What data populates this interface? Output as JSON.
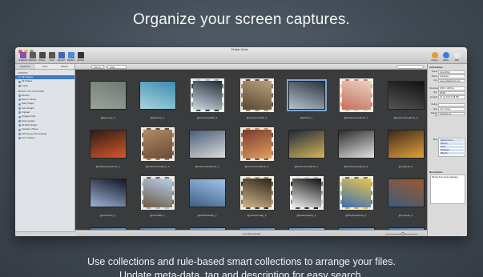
{
  "headline": "Organize your screen captures.",
  "caption": {
    "line1": "Use collections and rule-based smart collections to arrange your files.",
    "line2": "Update meta-data, tag and description for easy search."
  },
  "window": {
    "title": "Pebble Shots",
    "toolbar_left": [
      {
        "label": "Organizer",
        "icon": "organizer-icon",
        "color": "#8a4fb7"
      },
      {
        "label": "Selection",
        "icon": "selection-icon",
        "color": "#5a5a5a"
      },
      {
        "label": "Screen",
        "icon": "screen-icon",
        "color": "#4a4a4a"
      },
      {
        "label": "Timer",
        "icon": "timer-icon",
        "color": "#555555"
      },
      {
        "label": "Record",
        "icon": "record-icon",
        "color": "#3a67b8"
      },
      {
        "label": "Window",
        "icon": "window-icon",
        "color": "#4f87d6"
      },
      {
        "label": "Camera",
        "icon": "camera-icon",
        "color": "#333333"
      }
    ],
    "toolbar_right": [
      {
        "label": "Photos",
        "icon": "photos-icon",
        "color": "#e59a3a"
      },
      {
        "label": "Share",
        "icon": "share-icon",
        "color": "#3b7de0"
      },
      {
        "label": "PDF",
        "icon": "pdf-icon",
        "color": "#e8e8e8"
      }
    ],
    "pathbar": {
      "view_label": "Sort by",
      "sort_value": "Date"
    },
    "sidebar": {
      "tabs": [
        "Organizer",
        "Tools",
        "Effects"
      ],
      "library_heading": "LIBRARY",
      "library_items": [
        "All Images",
        "All Videos",
        "Trash"
      ],
      "smart_heading": "SMART COLLECTIONS",
      "smart_items": [
        "Recent",
        "Screen Shots",
        "Web Snaps",
        "Cam Snaps",
        "Clipped",
        "Dragged Out",
        "Screencasts",
        "All Web Snaps",
        "Favorite Videos",
        "iOS Screen Recordings",
        "Cam Videos"
      ]
    },
    "grid": {
      "rows": [
        [
          "@jaybunty_1",
          "@jaybunty_3",
          "@JCoyneCylalia_3",
          "@JCoyneCylalia_2",
          "@jrlinker_1",
          "@dearlovesnaphots_1",
          "@dearlovesnaphots_2"
        ],
        [
          "@dearlovesnaphots_4",
          "@dearlovesnaphots_3",
          "@dearlovesnaphots_5",
          "@dearlovesnaphots_6",
          "@dearlovesnaphots_7",
          "@dearlovesnaphots_8",
          "@7speeds_2"
        ],
        [
          "@oscaronm_3",
          "@marshaIk_1",
          "@NicDanielson_1",
          "@polzeeronfilly_3",
          "@dearlopelsoln_1",
          "@lifeofsnapshots_1",
          "@7speeds_4"
        ],
        [
          "",
          "",
          "",
          "",
          "",
          "",
          ""
        ]
      ],
      "status": "1 of 128 selected"
    },
    "inspector": {
      "heading": "Information",
      "fields": [
        {
          "label": "Name",
          "value": "Anna Zhen"
        },
        {
          "label": "Album",
          "value": "Instagram"
        },
        {
          "label": "Link",
          "value": "www.pebbleshots.com"
        },
        {
          "label": "Dimensions",
          "value": "1000 x 1000 px"
        },
        {
          "label": "Size",
          "value": "98 KB"
        },
        {
          "label": "Created",
          "value": "15 Jul 2013 5:48 PM"
        },
        {
          "label": "Rating",
          "value": ""
        },
        {
          "label": "Type",
          "value": "Cam Snaps"
        },
        {
          "label": "Shared by",
          "value": "Dragged out"
        }
      ],
      "tags_label": "Tags",
      "tags": [
        "#Monochrome",
        "#Nature",
        "#Kids",
        "#Holidays",
        "#Beach"
      ],
      "description_heading": "Description",
      "description": "Photos from travel catalogue"
    }
  }
}
